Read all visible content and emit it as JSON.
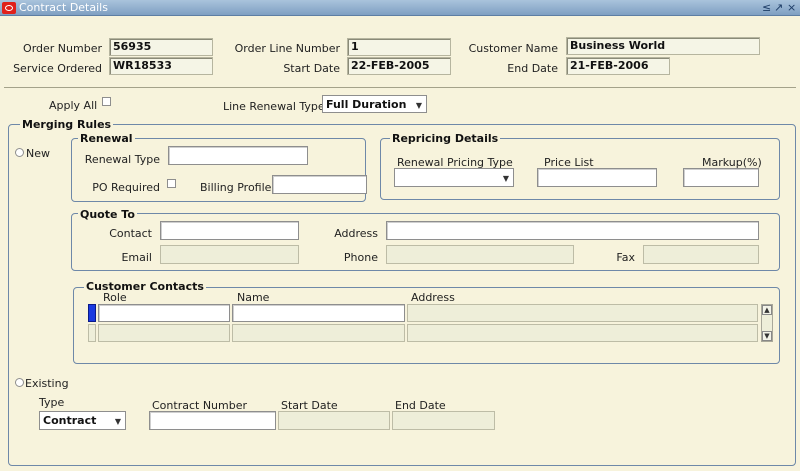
{
  "window": {
    "title": "Contract Details",
    "controls": [
      "≤",
      "↗",
      "×"
    ]
  },
  "header": {
    "order_number_label": "Order Number",
    "order_number": "56935",
    "order_line_number_label": "Order Line Number",
    "order_line_number": "1",
    "customer_name_label": "Customer Name",
    "customer_name": "Business World",
    "service_ordered_label": "Service Ordered",
    "service_ordered": "WR18533",
    "start_date_label": "Start Date",
    "start_date": "22-FEB-2005",
    "end_date_label": "End Date",
    "end_date": "21-FEB-2006"
  },
  "options": {
    "apply_all_label": "Apply All",
    "line_renewal_type_label": "Line Renewal Type",
    "line_renewal_type": "Full Duration"
  },
  "merging_rules": {
    "title": "Merging Rules",
    "new_label": "New",
    "existing_label": "Existing",
    "renewal": {
      "title": "Renewal",
      "renewal_type_label": "Renewal Type",
      "po_required_label": "PO Required",
      "billing_profile_label": "Billing Profile"
    },
    "repricing": {
      "title": "Repricing Details",
      "renewal_pricing_type_label": "Renewal Pricing Type",
      "price_list_label": "Price List",
      "markup_label": "Markup(%)"
    },
    "quote_to": {
      "title": "Quote To",
      "contact_label": "Contact",
      "address_label": "Address",
      "email_label": "Email",
      "phone_label": "Phone",
      "fax_label": "Fax"
    },
    "customer_contacts": {
      "title": "Customer Contacts",
      "columns": [
        "Role",
        "Name",
        "Address"
      ]
    },
    "existing": {
      "type_label": "Type",
      "type_value": "Contract",
      "contract_number_label": "Contract Number",
      "start_date_label": "Start Date",
      "end_date_label": "End Date"
    }
  }
}
